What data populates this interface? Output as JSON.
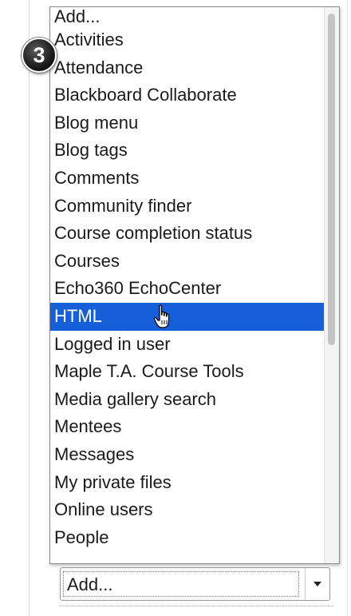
{
  "step_badge": {
    "number": "3"
  },
  "dropdown": {
    "items": [
      {
        "label": "Add..."
      },
      {
        "label": "Activities"
      },
      {
        "label": "Attendance"
      },
      {
        "label": "Blackboard Collaborate"
      },
      {
        "label": "Blog menu"
      },
      {
        "label": "Blog tags"
      },
      {
        "label": "Comments"
      },
      {
        "label": "Community finder"
      },
      {
        "label": "Course completion status"
      },
      {
        "label": "Courses"
      },
      {
        "label": "Echo360 EchoCenter"
      },
      {
        "label": "HTML"
      },
      {
        "label": "Logged in user"
      },
      {
        "label": "Maple T.A. Course Tools"
      },
      {
        "label": "Media gallery search"
      },
      {
        "label": "Mentees"
      },
      {
        "label": "Messages"
      },
      {
        "label": "My private files"
      },
      {
        "label": "Online users"
      },
      {
        "label": "People"
      }
    ],
    "selected_label": "HTML",
    "selection_color": "#1560d9"
  },
  "select": {
    "value": "Add..."
  },
  "icons": {
    "cursor": "hand-pointer-icon",
    "arrow": "chevron-down-icon"
  }
}
